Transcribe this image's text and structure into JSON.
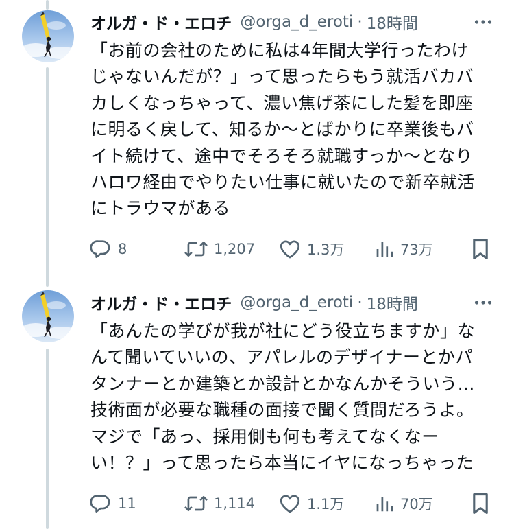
{
  "tweets": [
    {
      "display_name": "オルガ・ド・エロチ",
      "handle": "@orga_d_eroti",
      "separator": "·",
      "time": "18時間",
      "lines": [
        "「お前の会社のために私は4年間大学行ったわけ",
        "じゃないんだが？」って思ったらもう就活バカバ",
        "カしくなっちゃって、濃い焦げ茶にした髪を即座",
        "に明るく戻して、知るか〜とばかりに卒業後もバ",
        "イト続けて、途中でそろそろ就職すっか〜となり",
        "ハロワ経由でやりたい仕事に就いたので新卒就活",
        "にトラウマがある"
      ],
      "replies": "8",
      "retweets": "1,207",
      "likes": "1.3万",
      "views": "73万"
    },
    {
      "display_name": "オルガ・ド・エロチ",
      "handle": "@orga_d_eroti",
      "separator": "·",
      "time": "18時間",
      "lines": [
        "「あんたの学びが我が社にどう役立ちますか」な",
        "んて聞いていいの、アパレルのデザイナーとかパ",
        "タンナーとか建築とか設計とかなんかそういう…",
        "技術面が必要な職種の面接で聞く質問だろうよ。",
        "マジで「あっ、採用側も何も考えてなくなー",
        "い！？」って思ったら本当にイヤになっちゃった"
      ],
      "replies": "11",
      "retweets": "1,114",
      "likes": "1.1万",
      "views": "70万"
    }
  ],
  "icons": {
    "more": "more-horizontal-icon",
    "reply": "reply-icon",
    "retweet": "retweet-icon",
    "like": "heart-icon",
    "views": "views-icon",
    "bookmark": "bookmark-icon"
  },
  "colors": {
    "text": "#0f1419",
    "secondary": "#536471",
    "thread_line": "#cfd9de"
  }
}
